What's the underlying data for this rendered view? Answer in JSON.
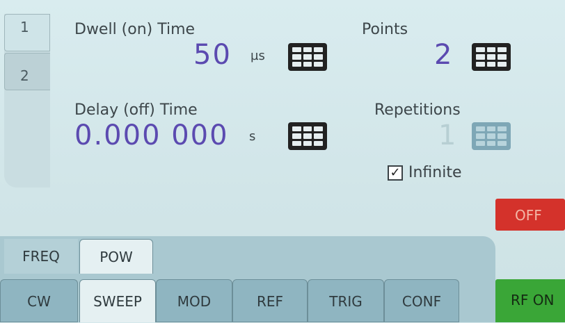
{
  "subtabs": [
    {
      "label": "1"
    },
    {
      "label": "2"
    }
  ],
  "dwell": {
    "label": "Dwell (on) Time",
    "value": "50",
    "unit": "µs"
  },
  "points": {
    "label": "Points",
    "value": "2"
  },
  "delay": {
    "label": "Delay (off) Time",
    "value": "0.000 000",
    "unit": "s"
  },
  "repetitions": {
    "label": "Repetitions",
    "value": "1"
  },
  "infinite": {
    "label": "Infinite",
    "checked": true,
    "check_glyph": "✓"
  },
  "output_state_button": {
    "label": "OFF"
  },
  "sweep_mode_tabs": [
    {
      "label": "FREQ",
      "active": false
    },
    {
      "label": "POW",
      "active": true
    }
  ],
  "main_tabs": [
    {
      "label": "CW",
      "active": false
    },
    {
      "label": "SWEEP",
      "active": true
    },
    {
      "label": "MOD",
      "active": false
    },
    {
      "label": "REF",
      "active": false
    },
    {
      "label": "TRIG",
      "active": false
    },
    {
      "label": "CONF",
      "active": false
    }
  ],
  "rf_button": {
    "label": "RF ON"
  },
  "colors": {
    "value_text": "#5b4ab0",
    "off_button": "#d4322b",
    "rf_on_button": "#3aa637",
    "background": "#d4e7ea"
  },
  "icons": {
    "keypad": "keypad-icon"
  }
}
